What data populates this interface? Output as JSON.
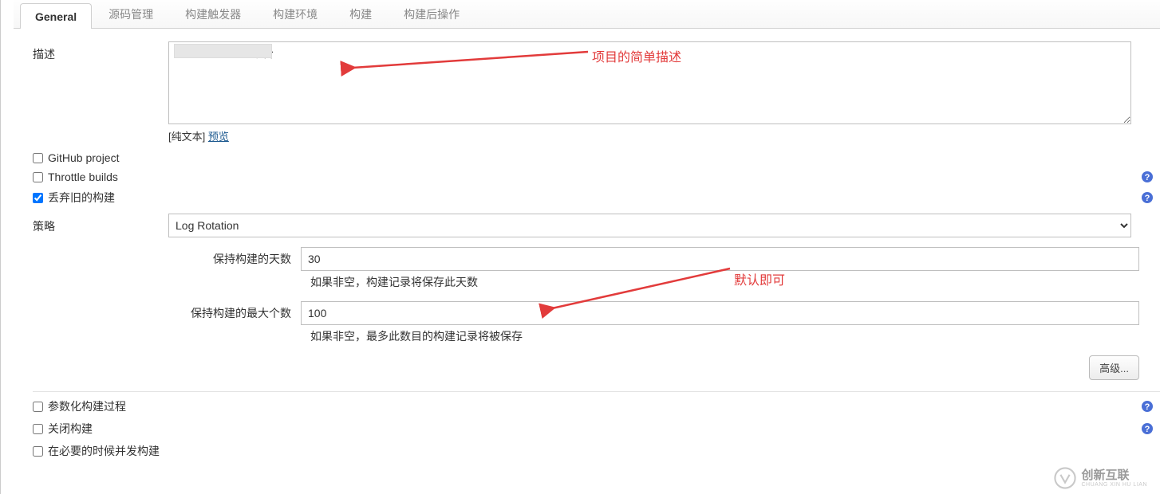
{
  "tabs": [
    {
      "id": "general",
      "label": "General",
      "active": true
    },
    {
      "id": "scm",
      "label": "源码管理",
      "active": false
    },
    {
      "id": "triggers",
      "label": "构建触发器",
      "active": false
    },
    {
      "id": "env",
      "label": "构建环境",
      "active": false
    },
    {
      "id": "build",
      "label": "构建",
      "active": false
    },
    {
      "id": "post",
      "label": "构建后操作",
      "active": false
    }
  ],
  "description": {
    "label": "描述",
    "value": "                         平台",
    "plain_prefix": "[纯文本] ",
    "preview_link": "预览"
  },
  "checkboxes": {
    "github_project": {
      "label": "GitHub project",
      "checked": false
    },
    "throttle_builds": {
      "label": "Throttle builds",
      "checked": false,
      "help": true
    },
    "discard_old": {
      "label": "丢弃旧的构建",
      "checked": true,
      "help": true
    },
    "param_build": {
      "label": "参数化构建过程",
      "checked": false,
      "help": true
    },
    "disable_build": {
      "label": "关闭构建",
      "checked": false,
      "help": true
    },
    "concurrent": {
      "label": "在必要的时候并发构建",
      "checked": false
    }
  },
  "strategy": {
    "label": "策略",
    "selected": "Log Rotation"
  },
  "retention": {
    "days": {
      "label": "保持构建的天数",
      "value": "30",
      "hint": "如果非空，构建记录将保存此天数"
    },
    "count": {
      "label": "保持构建的最大个数",
      "value": "100",
      "hint": "如果非空，最多此数目的构建记录将被保存"
    }
  },
  "advanced_button": "高级...",
  "annotations": {
    "desc": "项目的简单描述",
    "default": "默认即可"
  },
  "watermark": {
    "title": "创新互联",
    "sub": "CHUANG XIN HU LIAN"
  }
}
